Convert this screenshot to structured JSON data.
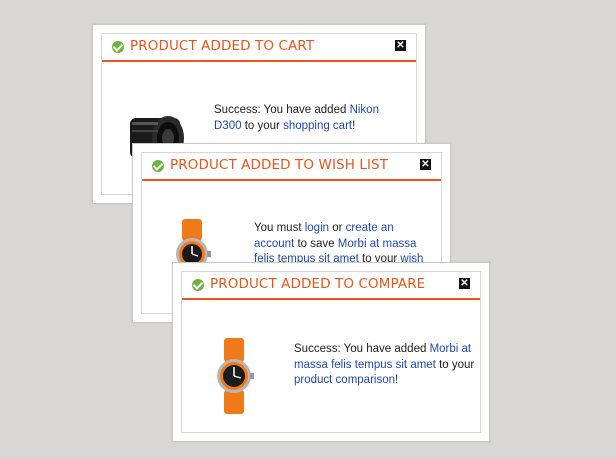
{
  "popups": {
    "cart": {
      "title": "PRODUCT ADDED TO CART",
      "msg_before": "Success: You have added ",
      "product_link": "Nikon D300",
      "msg_middle": " to your ",
      "target_link": "shopping cart",
      "msg_after": "!",
      "image_icon": "camera-lens-icon"
    },
    "wishlist": {
      "title": "PRODUCT ADDED TO WISH LIST",
      "msg_before": "You must ",
      "login_link": "login",
      "msg_or": " or ",
      "create_link": "create an account",
      "msg_to_save": " to save ",
      "product_link": "Morbi at massa felis tempus sit amet",
      "msg_to_your": " to your ",
      "target_link": "wish list",
      "msg_after": "!",
      "image_icon": "orange-watch-icon"
    },
    "compare": {
      "title": "PRODUCT ADDED TO COMPARE",
      "msg_before": "Success: You have added ",
      "product_link": "Morbi at massa felis tempus sit amet",
      "msg_middle": " to your ",
      "target_link": "product comparison",
      "msg_after": "!",
      "image_icon": "orange-watch-icon"
    }
  },
  "colors": {
    "accent": "#e9541b",
    "link": "#2248a8",
    "success": "#6cb33f",
    "background": "#d8d7d5"
  }
}
